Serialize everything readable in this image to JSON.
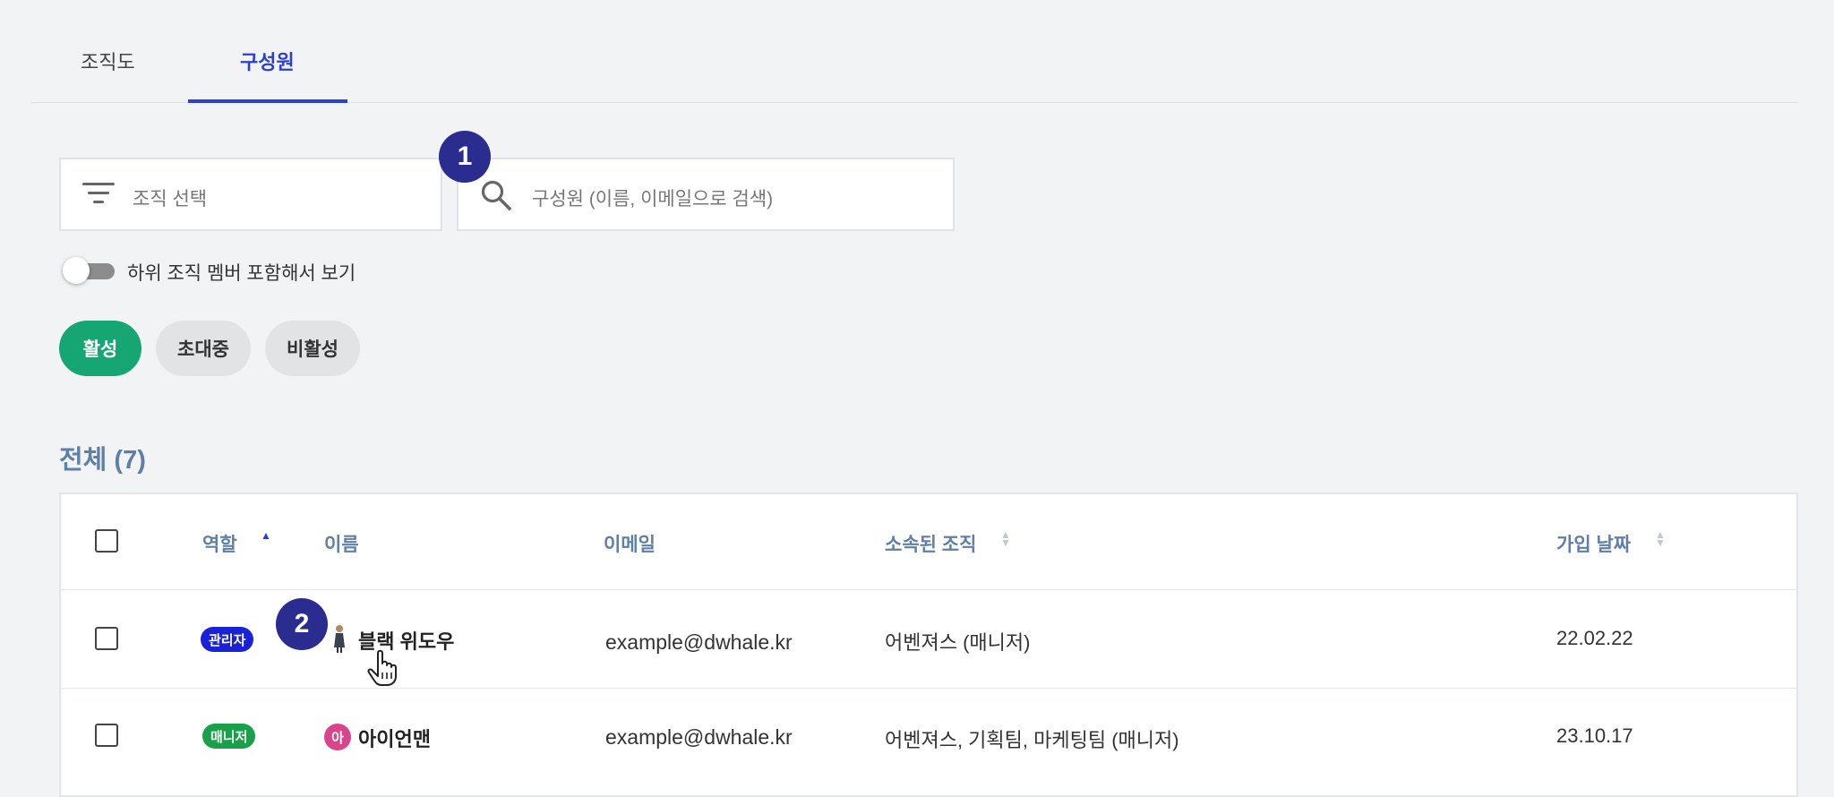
{
  "tabs": [
    {
      "label": "조직도",
      "active": false
    },
    {
      "label": "구성원",
      "active": true
    }
  ],
  "filters": {
    "org_select_placeholder": "조직 선택",
    "search_placeholder": "구성원 (이름, 이메일으로 검색)"
  },
  "callouts": [
    "1",
    "2"
  ],
  "toggle": {
    "label": "하위 조직 멤버 포함해서 보기",
    "on": false
  },
  "status_pills": [
    {
      "label": "활성",
      "selected": true
    },
    {
      "label": "초대중",
      "selected": false
    },
    {
      "label": "비활성",
      "selected": false
    }
  ],
  "total_label": "전체 (7)",
  "table": {
    "headers": {
      "role": "역할",
      "name": "이름",
      "email": "이메일",
      "org": "소속된 조직",
      "joined": "가입 날짜"
    },
    "rows": [
      {
        "role": "관리자",
        "name": "블랙 위도우",
        "email": "example@dwhale.kr",
        "org": "어벤져스 (매니저)",
        "joined": "22.02.22"
      },
      {
        "role": "매니저",
        "avatar_letter": "아",
        "name": "아이언맨",
        "email": "example@dwhale.kr",
        "org": "어벤져스, 기획팀, 마케팅팀 (매니저)",
        "joined": "23.10.17"
      }
    ]
  },
  "colors": {
    "accent": "#2b3fd0",
    "active_pill": "#16a673",
    "admin_badge": "#1a22d8",
    "manager_badge": "#18a149",
    "callout": "#2a2c8f",
    "header_text": "#5f7fa6"
  },
  "icons": [
    "filter-icon",
    "search-icon",
    "sort-icon",
    "hand-cursor-icon"
  ]
}
